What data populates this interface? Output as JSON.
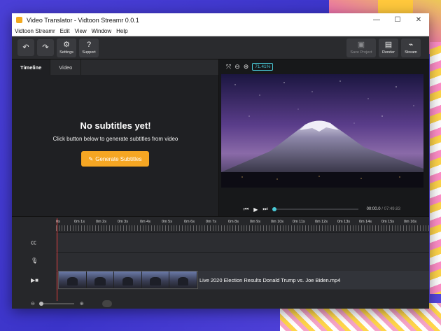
{
  "window": {
    "title": "Video Translator - Vidtoon Streamr 0.0.1",
    "controls": [
      "minimize",
      "maximize",
      "close"
    ]
  },
  "menu": [
    "Vidtoon Streamr",
    "Edit",
    "View",
    "Window",
    "Help"
  ],
  "toolbar": {
    "undo_icon": "undo-icon",
    "redo_icon": "redo-icon",
    "settings": "Settings",
    "support": "Support",
    "save_project": "Save Project",
    "render": "Render",
    "stream": "Stream"
  },
  "tabs": [
    "Timeline",
    "Video"
  ],
  "empty_state": {
    "title": "No subtitles yet!",
    "subtitle": "Click button below to generate subtitles from video",
    "button": "Generate Subtitles"
  },
  "preview": {
    "zoom": "71.41%"
  },
  "player": {
    "current_time": "00:00.0",
    "total_time": "07:49.83",
    "progress": 0
  },
  "timeline": {
    "ticks": [
      "0s",
      "0m 1s",
      "0m 2s",
      "0m 3s",
      "0m 4s",
      "0m 5s",
      "0m 6s",
      "0m 7s",
      "0m 8s",
      "0m 9s",
      "0m 10s",
      "0m 11s",
      "0m 12s",
      "0m 13s",
      "0m 14s",
      "0m 15s",
      "0m 16s"
    ],
    "clip_name": "Live 2020 Election Results Donald Trump vs. Joe Biden.mp4",
    "rows": [
      "cc-icon",
      "microphone-icon",
      "video-camera-icon"
    ]
  },
  "colors": {
    "accent": "#f5a623",
    "teal": "#49c9d6",
    "playhead": "#e03c3c"
  }
}
